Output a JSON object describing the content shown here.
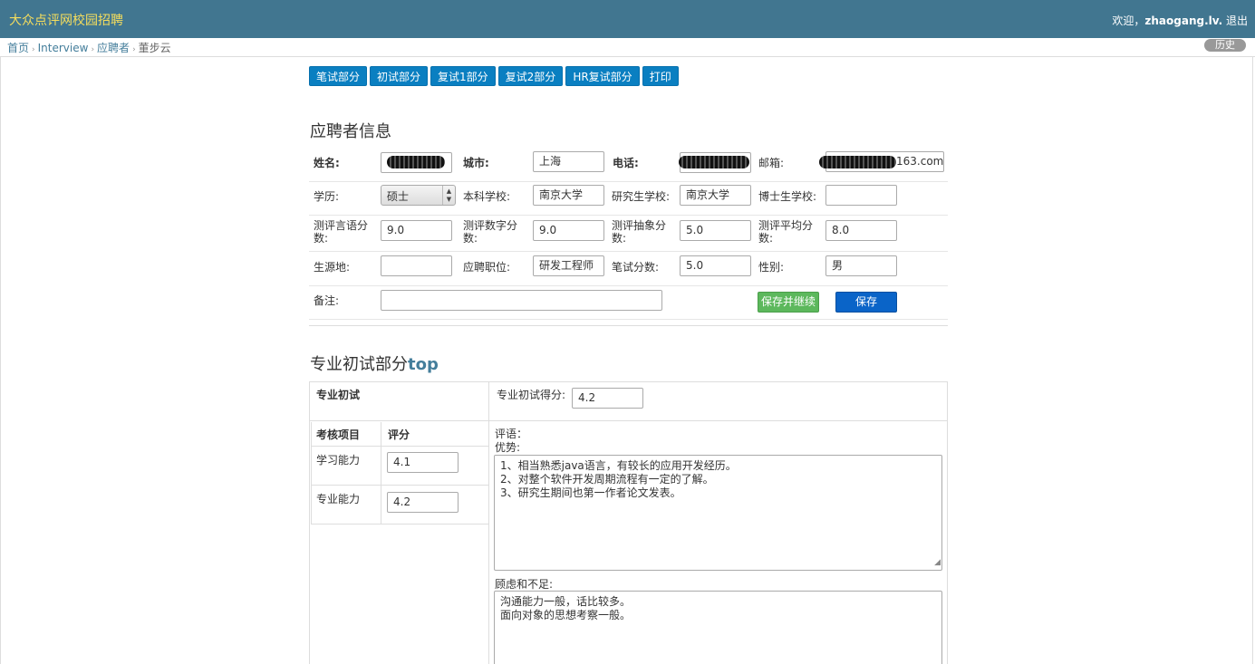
{
  "header": {
    "site_title": "大众点评网校园招聘",
    "welcome": "欢迎，",
    "username": "zhaogang.lv.",
    "logout": "退出"
  },
  "breadcrumbs": {
    "items": [
      "首页",
      "Interview",
      "应聘者"
    ],
    "current": "董步云",
    "separator": "›",
    "history": "历史"
  },
  "tabs": [
    "笔试部分",
    "初试部分",
    "复试1部分",
    "复试2部分",
    "HR复试部分",
    "打印"
  ],
  "applicant_info": {
    "title": "应聘者信息",
    "name_label": "姓名:",
    "city_label": "城市:",
    "city_value": "上海",
    "phone_label": "电话:",
    "email_label": "邮箱:",
    "email_suffix": "163.com",
    "education_label": "学历:",
    "education_value": "硕士",
    "undergrad_label": "本科学校:",
    "undergrad_value": "南京大学",
    "grad_label": "研究生学校:",
    "grad_value": "南京大学",
    "phd_label": "博士生学校:",
    "phd_value": "",
    "lang_score_label": "测评言语分数:",
    "lang_score_value": "9.0",
    "num_score_label": "测评数字分数:",
    "num_score_value": "9.0",
    "abstract_score_label": "测评抽象分数:",
    "abstract_score_value": "5.0",
    "avg_score_label": "测评平均分数:",
    "avg_score_value": "8.0",
    "origin_label": "生源地:",
    "origin_value": "",
    "position_label": "应聘职位:",
    "position_value": "研发工程师",
    "written_score_label": "笔试分数:",
    "written_score_value": "5.0",
    "gender_label": "性别:",
    "gender_value": "男",
    "note_label": "备注:",
    "note_value": "",
    "save_continue": "保存并继续",
    "save": "保存"
  },
  "professional": {
    "title": "专业初试部分",
    "top_link": "top",
    "section_label": "专业初试",
    "score_label": "专业初试得分:",
    "score_value": "4.2",
    "col_item": "考核项目",
    "col_score": "评分",
    "items": [
      {
        "name": "学习能力",
        "score": "4.1"
      },
      {
        "name": "专业能力",
        "score": "4.2"
      }
    ],
    "comment_label": "评语：",
    "strengths_label": "优势:",
    "strengths_lines": [
      "1、相当熟悉java语言，有较长的应用开发经历。",
      "2、对整个软件开发周期流程有一定的了解。",
      "3、研究生期间也第一作者论文发表。"
    ],
    "concerns_label": "顾虑和不足:",
    "concerns_lines": [
      "沟通能力一般，话比较多。",
      "面向对象的思想考察一般。"
    ]
  }
}
